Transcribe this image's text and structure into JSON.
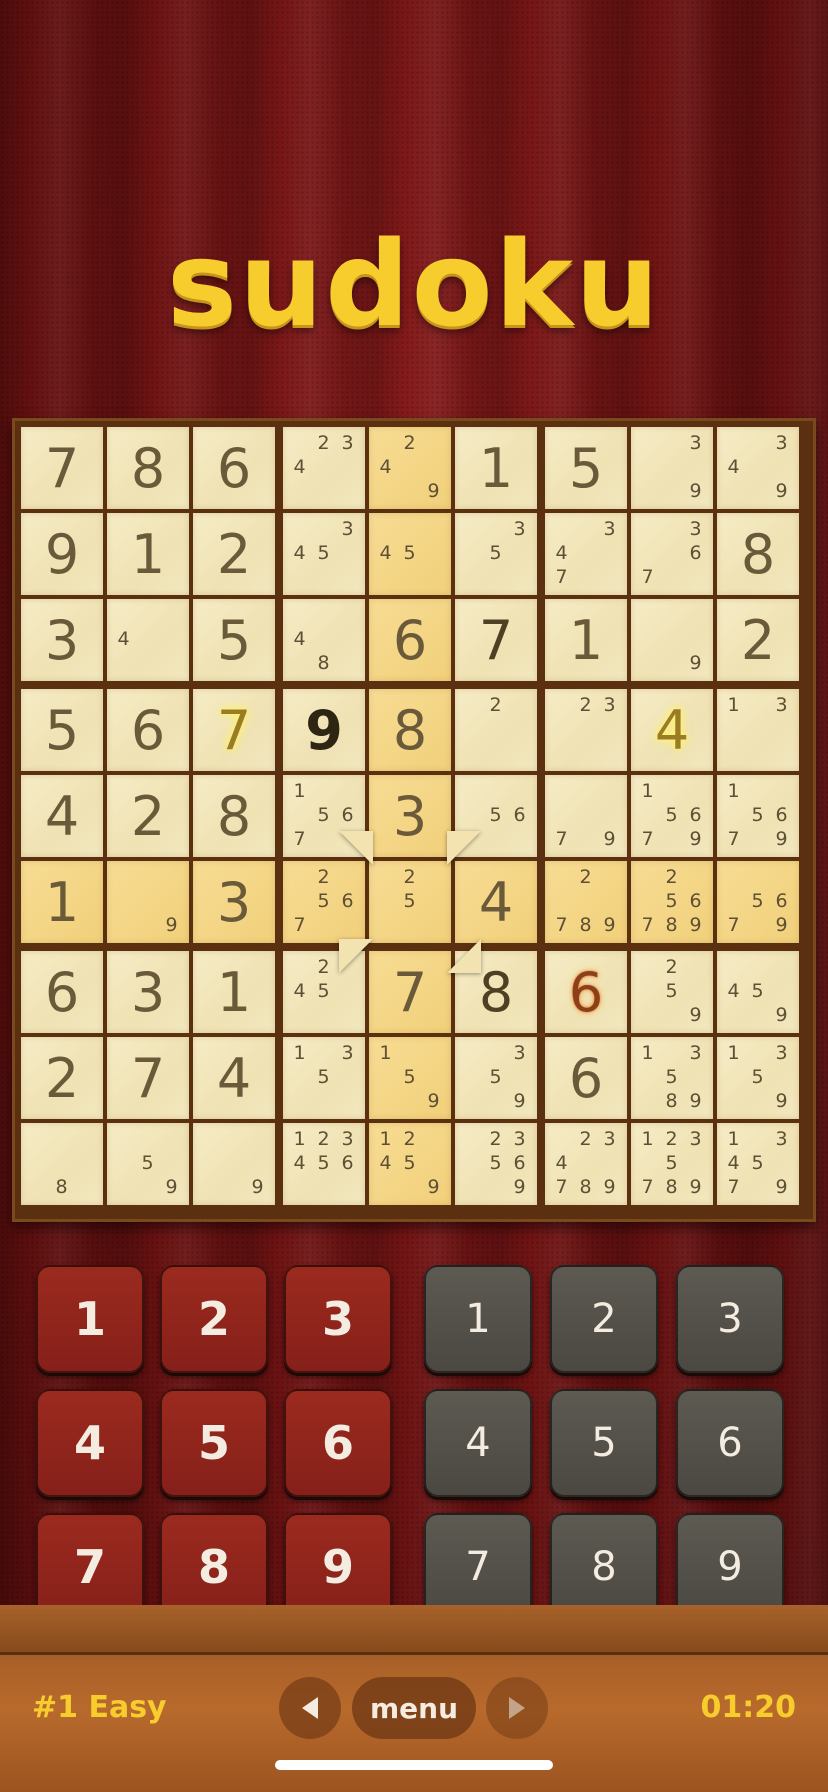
{
  "app": {
    "title": "sudoku"
  },
  "board": {
    "rows": [
      [
        {
          "v": "7",
          "t": "given"
        },
        {
          "v": "8",
          "t": "given"
        },
        {
          "v": "6",
          "t": "given"
        },
        {
          "n": [
            "2",
            "3",
            "4"
          ]
        },
        {
          "n": [
            "2",
            "4",
            "9"
          ]
        },
        {
          "v": "1",
          "t": "given"
        },
        {
          "v": "5",
          "t": "given"
        },
        {
          "n": [
            "3",
            "9"
          ]
        },
        {
          "n": [
            "3",
            "4",
            "9"
          ]
        }
      ],
      [
        {
          "v": "9",
          "t": "given"
        },
        {
          "v": "1",
          "t": "given"
        },
        {
          "v": "2",
          "t": "given"
        },
        {
          "n": [
            "3",
            "4",
            "5"
          ]
        },
        {
          "n": [
            "4",
            "5"
          ]
        },
        {
          "n": [
            "3",
            "5"
          ]
        },
        {
          "n": [
            "3",
            "4",
            "7"
          ]
        },
        {
          "n": [
            "3",
            "6",
            "7"
          ]
        },
        {
          "v": "8",
          "t": "given"
        }
      ],
      [
        {
          "v": "3",
          "t": "given"
        },
        {
          "n": [
            "4"
          ]
        },
        {
          "v": "5",
          "t": "given"
        },
        {
          "n": [
            "4",
            "8"
          ]
        },
        {
          "v": "6",
          "t": "given"
        },
        {
          "v": "7",
          "t": "player"
        },
        {
          "v": "1",
          "t": "given"
        },
        {
          "n": [
            "9"
          ]
        },
        {
          "v": "2",
          "t": "given"
        }
      ],
      [
        {
          "v": "5",
          "t": "given"
        },
        {
          "v": "6",
          "t": "given"
        },
        {
          "v": "7",
          "t": "yellow"
        },
        {
          "v": "9",
          "t": "dark"
        },
        {
          "v": "8",
          "t": "given"
        },
        {
          "n": [
            "2"
          ]
        },
        {
          "n": [
            "2",
            "3"
          ]
        },
        {
          "v": "4",
          "t": "yellow"
        },
        {
          "n": [
            "1",
            "3"
          ]
        }
      ],
      [
        {
          "v": "4",
          "t": "given"
        },
        {
          "v": "2",
          "t": "given"
        },
        {
          "v": "8",
          "t": "given"
        },
        {
          "n": [
            "1",
            "5",
            "6",
            "7"
          ]
        },
        {
          "v": "3",
          "t": "given"
        },
        {
          "n": [
            "5",
            "6"
          ]
        },
        {
          "n": [
            "7",
            "9"
          ]
        },
        {
          "n": [
            "1",
            "5",
            "6",
            "7",
            "9"
          ]
        },
        {
          "n": [
            "1",
            "5",
            "6",
            "7",
            "9"
          ]
        }
      ],
      [
        {
          "v": "1",
          "t": "given"
        },
        {
          "n": [
            "9"
          ]
        },
        {
          "v": "3",
          "t": "given"
        },
        {
          "n": [
            "2",
            "5",
            "6",
            "7"
          ]
        },
        {
          "n": [
            "2",
            "5"
          ]
        },
        {
          "v": "4",
          "t": "given"
        },
        {
          "n": [
            "2",
            "7",
            "8",
            "9"
          ]
        },
        {
          "n": [
            "2",
            "5",
            "6",
            "7",
            "8",
            "9"
          ]
        },
        {
          "n": [
            "5",
            "6",
            "7",
            "9"
          ]
        }
      ],
      [
        {
          "v": "6",
          "t": "given"
        },
        {
          "v": "3",
          "t": "given"
        },
        {
          "v": "1",
          "t": "given"
        },
        {
          "n": [
            "2",
            "4",
            "5"
          ]
        },
        {
          "v": "7",
          "t": "given"
        },
        {
          "v": "8",
          "t": "player"
        },
        {
          "v": "6",
          "t": "orange"
        },
        {
          "n": [
            "2",
            "5",
            "9"
          ]
        },
        {
          "n": [
            "4",
            "5",
            "9"
          ]
        }
      ],
      [
        {
          "v": "2",
          "t": "given"
        },
        {
          "v": "7",
          "t": "given"
        },
        {
          "v": "4",
          "t": "given"
        },
        {
          "n": [
            "1",
            "3",
            "5"
          ]
        },
        {
          "n": [
            "1",
            "5",
            "9"
          ]
        },
        {
          "n": [
            "3",
            "5",
            "9"
          ]
        },
        {
          "v": "6",
          "t": "given"
        },
        {
          "n": [
            "1",
            "3",
            "5",
            "8",
            "9"
          ]
        },
        {
          "n": [
            "1",
            "3",
            "5",
            "9"
          ]
        }
      ],
      [
        {
          "n": [
            "8"
          ]
        },
        {
          "n": [
            "5",
            "9"
          ]
        },
        {
          "n": [
            "9"
          ]
        },
        {
          "n": [
            "1",
            "2",
            "3",
            "4",
            "5",
            "6"
          ]
        },
        {
          "n": [
            "1",
            "2",
            "4",
            "5",
            "9"
          ]
        },
        {
          "n": [
            "2",
            "3",
            "5",
            "6",
            "9"
          ]
        },
        {
          "n": [
            "2",
            "3",
            "4",
            "7",
            "8",
            "9"
          ]
        },
        {
          "n": [
            "1",
            "2",
            "3",
            "5",
            "7",
            "8",
            "9"
          ]
        },
        {
          "n": [
            "1",
            "3",
            "4",
            "5",
            "7",
            "9"
          ]
        }
      ]
    ]
  },
  "keypad": {
    "number_keys": [
      "1",
      "2",
      "3",
      "4",
      "5",
      "6",
      "7",
      "8",
      "9"
    ],
    "note_keys": [
      "1",
      "2",
      "3",
      "4",
      "5",
      "6",
      "7",
      "8",
      "9"
    ],
    "number_key_color": "#8f251c",
    "note_key_color": "#545149"
  },
  "footer": {
    "level": "#1 Easy",
    "menu_label": "menu",
    "timer": "01:20",
    "prev_icon": "triangle-left-icon",
    "next_icon": "triangle-right-icon"
  },
  "colors": {
    "title": "#f7cd2e",
    "highlight": "#f1d07a",
    "board_frame": "#5a3010",
    "footer_text": "#f7cd2e"
  }
}
